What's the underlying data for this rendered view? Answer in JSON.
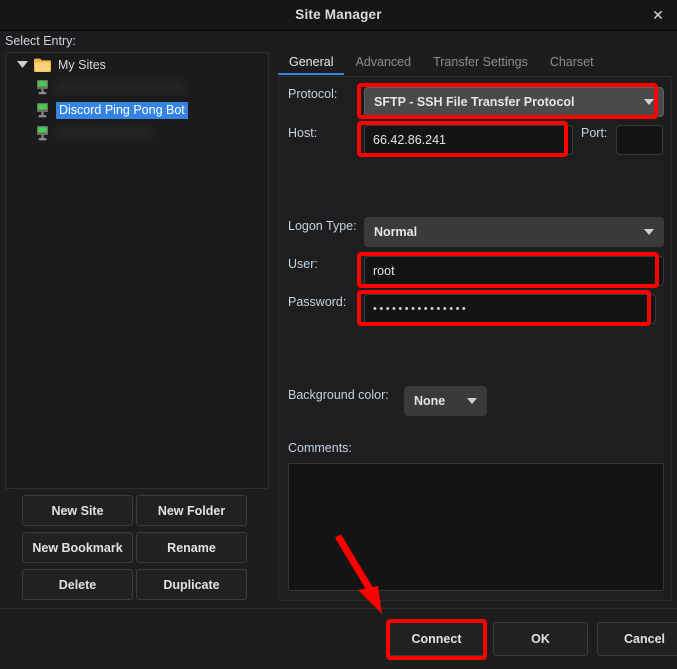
{
  "window": {
    "title": "Site Manager",
    "close_icon": "close-icon",
    "close_glyph": "✕"
  },
  "sidebar": {
    "select_entry_label": "Select Entry:",
    "tree": {
      "root": {
        "label": "My Sites",
        "icon": "folder-icon",
        "expanded": true,
        "expander_icon": "chevron-down-icon"
      },
      "children": [
        {
          "label": "",
          "icon": "server-icon",
          "selected": false,
          "redacted": true,
          "width": 128
        },
        {
          "label": "Discord Ping Pong Bot",
          "icon": "server-icon",
          "selected": true,
          "redacted": false,
          "width": 0
        },
        {
          "label": "",
          "icon": "server-icon",
          "selected": false,
          "redacted": true,
          "width": 96
        }
      ]
    },
    "buttons": [
      {
        "label": "New Site",
        "name": "new-site-button"
      },
      {
        "label": "New Folder",
        "name": "new-folder-button"
      },
      {
        "label": "New Bookmark",
        "name": "new-bookmark-button"
      },
      {
        "label": "Rename",
        "name": "rename-button"
      },
      {
        "label": "Delete",
        "name": "delete-button"
      },
      {
        "label": "Duplicate",
        "name": "duplicate-button"
      }
    ]
  },
  "tabs": [
    {
      "label": "General",
      "active": true
    },
    {
      "label": "Advanced",
      "active": false
    },
    {
      "label": "Transfer Settings",
      "active": false
    },
    {
      "label": "Charset",
      "active": false
    }
  ],
  "form": {
    "protocol": {
      "label": "Protocol:",
      "value": "SFTP - SSH File Transfer Protocol",
      "caret_icon": "chevron-down-icon"
    },
    "host": {
      "label": "Host:",
      "value": "66.42.86.241",
      "placeholder": ""
    },
    "port": {
      "label": "Port:",
      "value": "",
      "placeholder": ""
    },
    "logon_type": {
      "label": "Logon Type:",
      "value": "Normal",
      "caret_icon": "chevron-down-icon"
    },
    "user": {
      "label": "User:",
      "value": "root",
      "placeholder": ""
    },
    "password": {
      "label": "Password:",
      "value": "•••••••••••••••",
      "placeholder": ""
    },
    "background_color": {
      "label": "Background color:",
      "value": "None",
      "caret_icon": "chevron-down-icon"
    },
    "comments": {
      "label": "Comments:",
      "value": "",
      "placeholder": ""
    }
  },
  "footer": {
    "buttons": [
      {
        "label": "Connect",
        "name": "connect-button",
        "highlighted": true
      },
      {
        "label": "OK",
        "name": "ok-button",
        "highlighted": false
      },
      {
        "label": "Cancel",
        "name": "cancel-button",
        "highlighted": false
      }
    ]
  },
  "annotations": {
    "highlight_color": "#ff0000",
    "arrow_color": "#ff0000",
    "boxes": [
      {
        "target": "protocol-combobox"
      },
      {
        "target": "host-input"
      },
      {
        "target": "user-input"
      },
      {
        "target": "password-input"
      },
      {
        "target": "connect-button"
      }
    ],
    "arrow": {
      "points_to": "connect-button"
    }
  },
  "theme": {
    "accent": "#3584e4",
    "window_bg": "#1d1d1d",
    "titlebar_bg": "#161616",
    "label_color": "#c6d3e0",
    "selection_bg": "#3584e4"
  }
}
